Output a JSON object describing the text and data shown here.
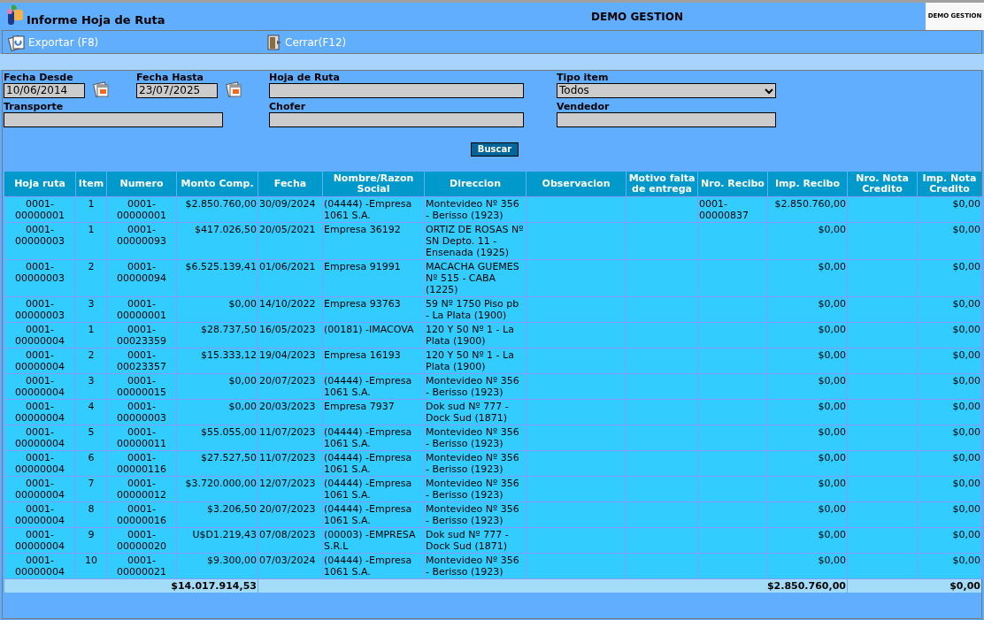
{
  "header": {
    "title": "Informe Hoja de Ruta",
    "company": "DEMO GESTION",
    "logo_text": "DEMO GESTION"
  },
  "toolbar": [
    {
      "label": "Exportar (F8)",
      "kind": "export"
    },
    {
      "label": "Cerrar(F12)",
      "kind": "close"
    }
  ],
  "filters": {
    "fecha_desde": {
      "label": "Fecha Desde",
      "value": "10/06/2014"
    },
    "fecha_hasta": {
      "label": "Fecha Hasta",
      "value": "23/07/2025"
    },
    "hoja_de_ruta": {
      "label": "Hoja de Ruta"
    },
    "tipo_item": {
      "label": "Tipo item",
      "value": "Todos"
    },
    "transporte": {
      "label": "Transporte"
    },
    "chofer": {
      "label": "Chofer"
    },
    "vendedor": {
      "label": "Vendedor"
    },
    "search_button": "Buscar"
  },
  "table": {
    "columns": [
      "Hoja ruta",
      "Item",
      "Numero",
      "Monto Comp.",
      "Fecha",
      "Nombre/Razon Social",
      "Direccion",
      "Observacion",
      "Motivo falta de entrega",
      "Nro. Recibo",
      "Imp. Recibo",
      "Nro. Nota Credito",
      "Imp. Nota Credito"
    ],
    "rows": [
      {
        "hoja": "0001-00000001",
        "item": "1",
        "numero": "0001-00000001",
        "monto": "$2.850.760,00",
        "fecha": "30/09/2024",
        "nombre": "(04444) -Empresa 1061 S.A.",
        "direccion": "Montevideo Nº 356 - Berisso (1923)",
        "nro_recibo": "0001-00000837",
        "imp_recibo": "$2.850.760,00",
        "imp_nota": "$0,00"
      },
      {
        "hoja": "0001-00000003",
        "item": "1",
        "numero": "0001-00000093",
        "monto": "$417.026,50",
        "fecha": "20/05/2021",
        "nombre": "Empresa 36192",
        "direccion": "ORTIZ DE ROSAS Nº SN Depto. 11 - Ensenada (1925)",
        "imp_recibo": "$0,00",
        "imp_nota": "$0,00"
      },
      {
        "hoja": "0001-00000003",
        "item": "2",
        "numero": "0001-00000094",
        "monto": "$6.525.139,41",
        "fecha": "01/06/2021",
        "nombre": "Empresa 91991",
        "direccion": "MACACHA GUEMES Nº 515 - CABA (1225)",
        "imp_recibo": "$0,00",
        "imp_nota": "$0,00"
      },
      {
        "hoja": "0001-00000003",
        "item": "3",
        "numero": "0001-00000001",
        "monto": "$0,00",
        "fecha": "14/10/2022",
        "nombre": "Empresa 93763",
        "direccion": "59 Nº 1750 Piso pb - La Plata (1900)",
        "imp_recibo": "$0,00",
        "imp_nota": "$0,00"
      },
      {
        "hoja": "0001-00000004",
        "item": "1",
        "numero": "0001-00023359",
        "monto": "$28.737,50",
        "fecha": "16/05/2023",
        "nombre": "(00181) -IMACOVA",
        "direccion": "120 Y 50 Nº 1 - La Plata (1900)",
        "imp_recibo": "$0,00",
        "imp_nota": "$0,00"
      },
      {
        "hoja": "0001-00000004",
        "item": "2",
        "numero": "0001-00023357",
        "monto": "$15.333,12",
        "fecha": "19/04/2023",
        "nombre": "Empresa 16193",
        "direccion": "120 Y 50 Nº 1 - La Plata (1900)",
        "imp_recibo": "$0,00",
        "imp_nota": "$0,00"
      },
      {
        "hoja": "0001-00000004",
        "item": "3",
        "numero": "0001-00000015",
        "monto": "$0,00",
        "fecha": "20/07/2023",
        "nombre": "(04444) -Empresa 1061 S.A.",
        "direccion": "Montevideo Nº 356 - Berisso (1923)",
        "imp_recibo": "$0,00",
        "imp_nota": "$0,00"
      },
      {
        "hoja": "0001-00000004",
        "item": "4",
        "numero": "0001-00000003",
        "monto": "$0,00",
        "fecha": "20/03/2023",
        "nombre": "Empresa 7937",
        "direccion": "Dok sud Nº 777 - Dock Sud (1871)",
        "imp_recibo": "$0,00",
        "imp_nota": "$0,00"
      },
      {
        "hoja": "0001-00000004",
        "item": "5",
        "numero": "0001-00000011",
        "monto": "$55.055,00",
        "fecha": "11/07/2023",
        "nombre": "(04444) -Empresa 1061 S.A.",
        "direccion": "Montevideo Nº 356 - Berisso (1923)",
        "imp_recibo": "$0,00",
        "imp_nota": "$0,00"
      },
      {
        "hoja": "0001-00000004",
        "item": "6",
        "numero": "0001-00000116",
        "monto": "$27.527,50",
        "fecha": "11/07/2023",
        "nombre": "(04444) -Empresa 1061 S.A.",
        "direccion": "Montevideo Nº 356 - Berisso (1923)",
        "imp_recibo": "$0,00",
        "imp_nota": "$0,00"
      },
      {
        "hoja": "0001-00000004",
        "item": "7",
        "numero": "0001-00000012",
        "monto": "$3.720.000,00",
        "fecha": "12/07/2023",
        "nombre": "(04444) -Empresa 1061 S.A.",
        "direccion": "Montevideo Nº 356 - Berisso (1923)",
        "imp_recibo": "$0,00",
        "imp_nota": "$0,00"
      },
      {
        "hoja": "0001-00000004",
        "item": "8",
        "numero": "0001-00000016",
        "monto": "$3.206,50",
        "fecha": "20/07/2023",
        "nombre": "(04444) -Empresa 1061 S.A.",
        "direccion": "Montevideo Nº 356 - Berisso (1923)",
        "imp_recibo": "$0,00",
        "imp_nota": "$0,00"
      },
      {
        "hoja": "0001-00000004",
        "item": "9",
        "numero": "0001-00000020",
        "monto": "U$D1.219,43",
        "fecha": "07/08/2023",
        "nombre": "(00003) -EMPRESA S.R.L",
        "direccion": "Dok sud Nº 777 - Dock Sud (1871)",
        "imp_recibo": "$0,00",
        "imp_nota": "$0,00"
      },
      {
        "hoja": "0001-00000004",
        "item": "10",
        "numero": "0001-00000021",
        "monto": "$9.300,00",
        "fecha": "07/03/2024",
        "nombre": "(04444) -Empresa 1061 S.A.",
        "direccion": "Montevideo Nº 356 - Berisso (1923)",
        "imp_recibo": "$0,00",
        "imp_nota": "$0,00"
      }
    ],
    "totals": {
      "monto": "$14.017.914,53",
      "imp_recibo": "$2.850.760,00",
      "imp_nota": "$0,00"
    }
  }
}
